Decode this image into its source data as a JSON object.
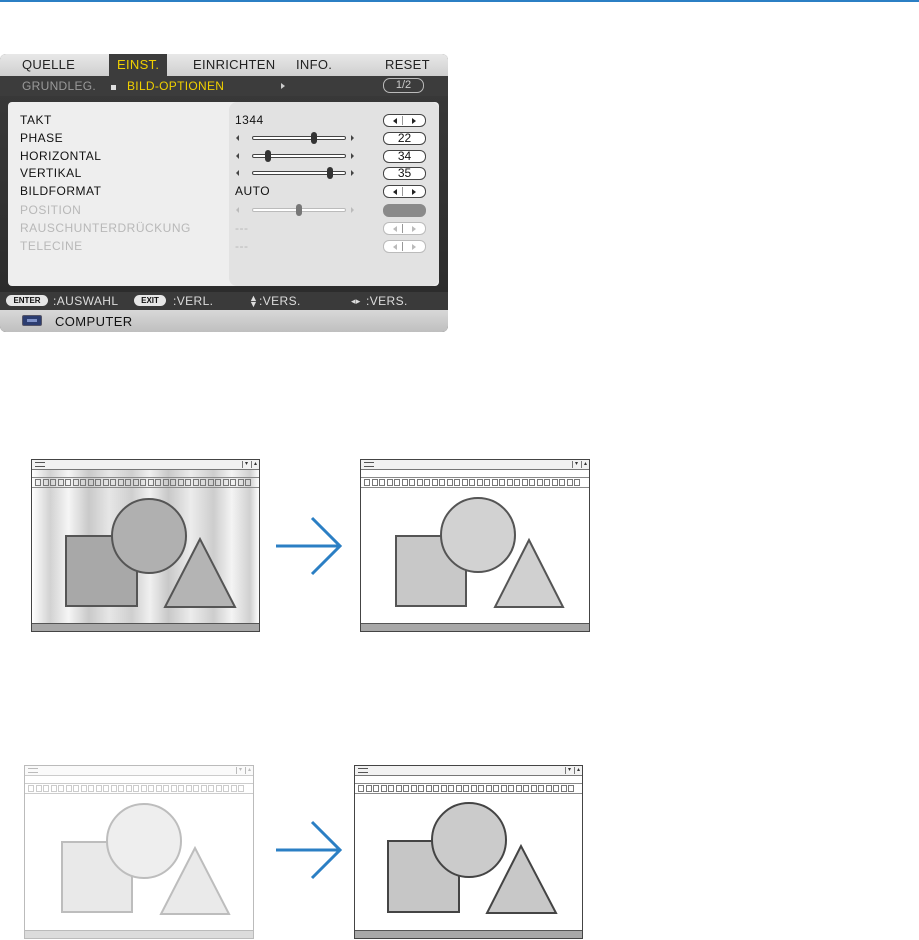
{
  "osd": {
    "tabs": [
      "QUELLE",
      "EINST.",
      "EINRICHTEN",
      "INFO.",
      "RESET"
    ],
    "subtabs": {
      "left": "GRUNDLEG.",
      "active": "BILD-OPTIONEN",
      "page": "1/2"
    },
    "rows": [
      {
        "label": "TAKT",
        "value": "1344",
        "control": "arrows",
        "enabled": true
      },
      {
        "label": "PHASE",
        "value": "22",
        "control": "slider",
        "level_percent": 67,
        "enabled": true
      },
      {
        "label": "HORIZONTAL",
        "value": "34",
        "control": "slider",
        "level_percent": 15,
        "enabled": true
      },
      {
        "label": "VERTIKAL",
        "value": "35",
        "control": "slider",
        "level_percent": 85,
        "enabled": true
      },
      {
        "label": "BILDFORMAT",
        "value": "AUTO",
        "control": "arrows",
        "enabled": true
      },
      {
        "label": "POSITION",
        "value": "",
        "control": "slider",
        "level_percent": 50,
        "enabled": false
      },
      {
        "label": "RAUSCHUNTERDRÜCKUNG",
        "value": "---",
        "control": "arrows",
        "enabled": false
      },
      {
        "label": "TELECINE",
        "value": "---",
        "control": "arrows",
        "enabled": false
      }
    ],
    "footer": {
      "enter_key": "ENTER",
      "enter_text": ":AUSWAHL",
      "exit_key": "EXIT",
      "exit_text": ":VERL.",
      "updown_text": ":VERS.",
      "leftright_text": ":VERS."
    },
    "source": "COMPUTER"
  },
  "icons": [
    "pc-input-icon",
    "left-arrow-icon",
    "right-arrow-icon",
    "up-down-arrow-icon",
    "left-right-arrow-icon",
    "window-menu-icon",
    "right-arrow-large-icon"
  ],
  "colors": {
    "accent_yellow": "#f0d000",
    "arrow_blue": "#2b7fc4",
    "menu_dark": "#3a3a3a"
  }
}
